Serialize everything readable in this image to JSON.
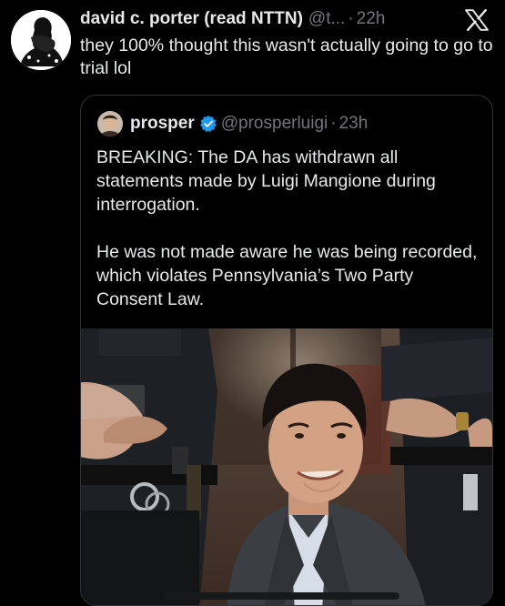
{
  "tweet": {
    "author_name": "david c. porter (read NTTN)",
    "author_handle": "@t...",
    "separator": "·",
    "time": "22h",
    "text": "they 100% thought this wasn't actually going to go to trial lol"
  },
  "quoted_tweet": {
    "author_name": "prosper",
    "author_handle": "@prosperluigi",
    "separator": "·",
    "time": "23h",
    "paragraphs": [
      "BREAKING: The DA has withdrawn all statements made by Luigi Mangione during interrogation.",
      "He was not made aware he was being recorded, which violates Pennsylvania’s Two Party Consent Law."
    ]
  },
  "colors": {
    "background": "#000000",
    "text_primary": "#e7e9ea",
    "text_secondary": "#71767b",
    "border": "#2f3336",
    "verified_badge": "#1d9bf0"
  },
  "icons": {
    "brand": "x-logo-icon",
    "verified": "verified-badge-icon"
  }
}
